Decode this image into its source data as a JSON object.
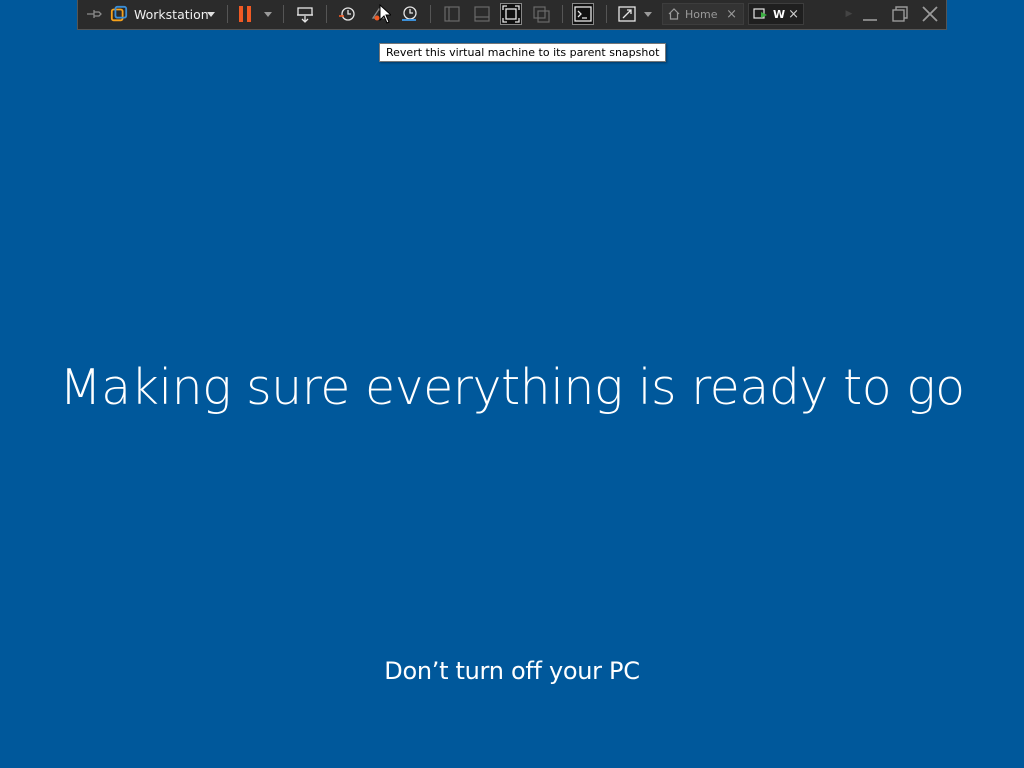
{
  "toolbar": {
    "app_name": "Workstation",
    "tabs": [
      {
        "label": "Home",
        "close": "×"
      },
      {
        "label": "W",
        "close": "×"
      }
    ],
    "icons": {
      "pin": "pin-icon",
      "logo": "vmware-logo-icon",
      "pause": "pause-icon",
      "send_keys": "send-ctrl-alt-del-icon",
      "snapshot_take": "take-snapshot-icon",
      "snapshot_revert": "revert-snapshot-icon",
      "snapshot_manager": "snapshot-manager-icon",
      "console": "console-view-icon",
      "fullscreen": "full-screen-icon",
      "stretch": "stretch-guest-icon"
    },
    "colors": {
      "background": "#2b2b2b",
      "pause_accent": "#f05a24",
      "logo_accent": "#f7a21b"
    }
  },
  "tooltip": {
    "text": "Revert this virtual machine to its parent snapshot"
  },
  "guest_screen": {
    "headline": "Making sure everything is ready to go",
    "subtitle": "Don’t turn off your PC",
    "background_color": "#00589b"
  }
}
